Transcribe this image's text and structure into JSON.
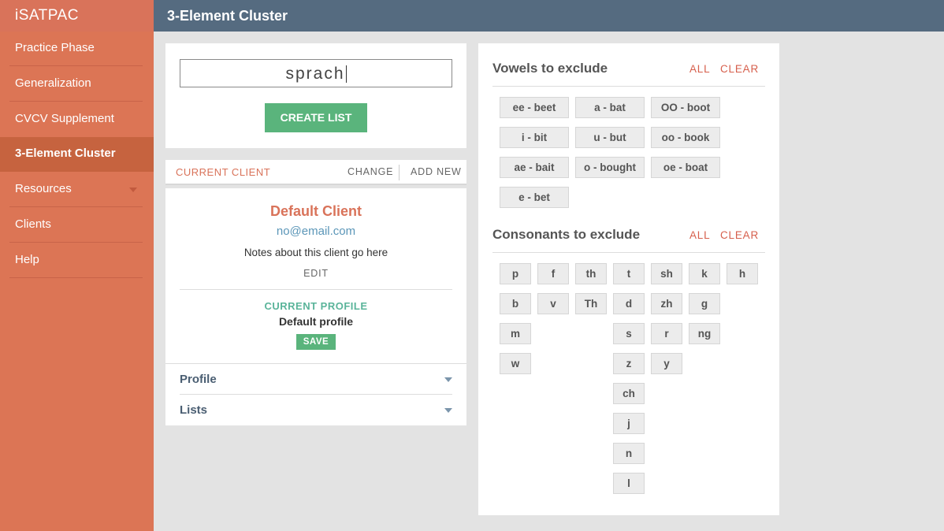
{
  "app": {
    "brand": "iSATPAC",
    "page_title": "3-Element Cluster"
  },
  "sidebar": {
    "items": [
      {
        "label": "Practice Phase"
      },
      {
        "label": "Generalization"
      },
      {
        "label": "CVCV Supplement"
      },
      {
        "label": "3-Element Cluster",
        "active": true
      },
      {
        "label": "Resources",
        "has_dropdown": true
      },
      {
        "label": "Clients"
      },
      {
        "label": "Help"
      }
    ]
  },
  "list_builder": {
    "input_value": "sprach",
    "create_label": "CREATE LIST"
  },
  "client": {
    "header_label": "CURRENT CLIENT",
    "change_label": "CHANGE",
    "add_new_label": "ADD NEW",
    "name": "Default Client",
    "email": "no@email.com",
    "notes": "Notes about this client go here",
    "edit_label": "EDIT",
    "profile_label": "CURRENT PROFILE",
    "profile_name": "Default profile",
    "save_label": "SAVE",
    "accordion": [
      {
        "label": "Profile"
      },
      {
        "label": "Lists"
      }
    ]
  },
  "vowels": {
    "title": "Vowels to exclude",
    "all_label": "ALL",
    "clear_label": "CLEAR",
    "items": [
      "ee - beet",
      "a - bat",
      "OO - boot",
      "i - bit",
      "u - but",
      "oo - book",
      "ae - bait",
      "o - bought",
      "oe - boat",
      "e - bet"
    ]
  },
  "consonants": {
    "title": "Consonants to exclude",
    "all_label": "ALL",
    "clear_label": "CLEAR",
    "items": [
      "p",
      "f",
      "th",
      "t",
      "sh",
      "k",
      "h",
      "b",
      "v",
      "Th",
      "d",
      "zh",
      "g",
      "m",
      "s",
      "r",
      "ng",
      "w",
      "z",
      "y",
      "ch",
      "j",
      "n",
      "l"
    ]
  }
}
